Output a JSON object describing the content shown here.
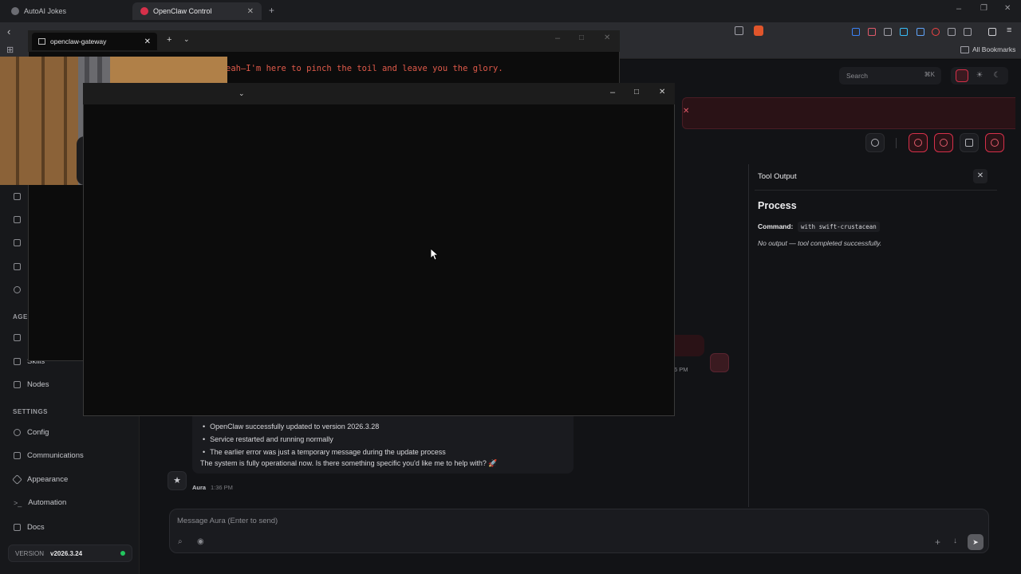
{
  "browser": {
    "tabs": [
      {
        "title": "AutoAI Jokes",
        "active": false
      },
      {
        "title": "OpenClaw Control",
        "active": true
      }
    ],
    "bookmarks_label": "All Bookmarks"
  },
  "terminal": {
    "tab_title": "openclaw-gateway",
    "visible_text": "eah—I'm here to pinch the toil and leave you the glory."
  },
  "sidebar": {
    "partial_section_label": "AGE",
    "items": [
      {
        "label": "Skills",
        "icon": "skills-icon"
      },
      {
        "label": "Nodes",
        "icon": "nodes-icon"
      }
    ],
    "settings_heading": "SETTINGS",
    "settings_items": [
      {
        "label": "Config",
        "icon": "gear-icon"
      },
      {
        "label": "Communications",
        "icon": "chat-icon"
      },
      {
        "label": "Appearance",
        "icon": "sparkle-icon"
      },
      {
        "label": "Automation",
        "icon": "terminal-icon"
      },
      {
        "label": "Docs",
        "icon": "book-icon"
      }
    ],
    "version_label": "VERSION",
    "version_value": "v2026.3.24",
    "status_color": "#22c55e"
  },
  "header": {
    "search_placeholder": "Search",
    "search_shortcut": "⌘K",
    "accent_color": "#d6304a"
  },
  "tool_output": {
    "title": "Tool Output",
    "heading": "Process",
    "command_label": "Command:",
    "command_value": "with swift-crustacean",
    "note": "No output — tool completed successfully."
  },
  "chat": {
    "partial_time": "6 PM",
    "assistant_message": {
      "bullets": [
        "OpenClaw successfully updated to version 2026.3.28",
        "Service restarted and running normally",
        "The earlier error was just a temporary message during the update process"
      ],
      "closing": "The system is fully operational now. Is there something specific you'd like me to help with? 🚀",
      "author": "Aura",
      "time": "1:36 PM"
    },
    "composer_placeholder": "Message Aura (Enter to send)"
  }
}
